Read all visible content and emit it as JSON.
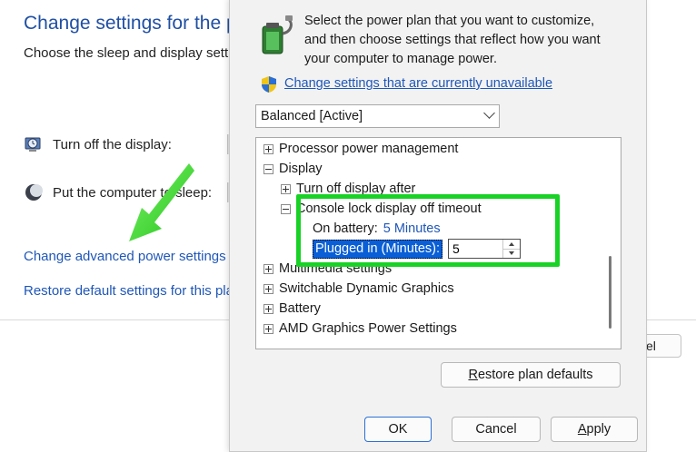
{
  "background": {
    "title": "Change settings for the pla",
    "subtitle": "Choose the sleep and display setti",
    "rows": [
      {
        "label": "Turn off the display:",
        "icon": "display-clock-icon"
      },
      {
        "label": "Put the computer to sleep:",
        "icon": "sleep-moon-icon"
      }
    ],
    "links": {
      "advanced": "Change advanced power settings",
      "restore": "Restore default settings for this pla"
    },
    "cancel_partial": "el"
  },
  "dialog": {
    "description_lines": [
      "Select the power plan that you want to customize,",
      "and then choose settings that reflect how you want",
      "your computer to manage power."
    ],
    "unavailable_link": "Change settings that are currently unavailable",
    "plan_select": "Balanced [Active]",
    "tree": {
      "processor": "Processor power management",
      "display": "Display",
      "turn_off_display": "Turn off display after",
      "console_lock": "Console lock display off timeout",
      "on_battery_label": "On battery:",
      "on_battery_value": "5 Minutes",
      "plugged_in_label": "Plugged in (Minutes):",
      "plugged_in_value": "5",
      "multimedia": "Multimedia settings",
      "switchable": "Switchable Dynamic Graphics",
      "battery": "Battery",
      "amd": "AMD Graphics Power Settings"
    },
    "restore_button_prefix": "R",
    "restore_button_rest": "estore plan defaults",
    "ok": "OK",
    "cancel": "Cancel",
    "apply_prefix": "A",
    "apply_rest": "pply"
  },
  "colors": {
    "highlight": "#18d226",
    "link": "#1f57b8",
    "selection": "#0a5fd6"
  }
}
